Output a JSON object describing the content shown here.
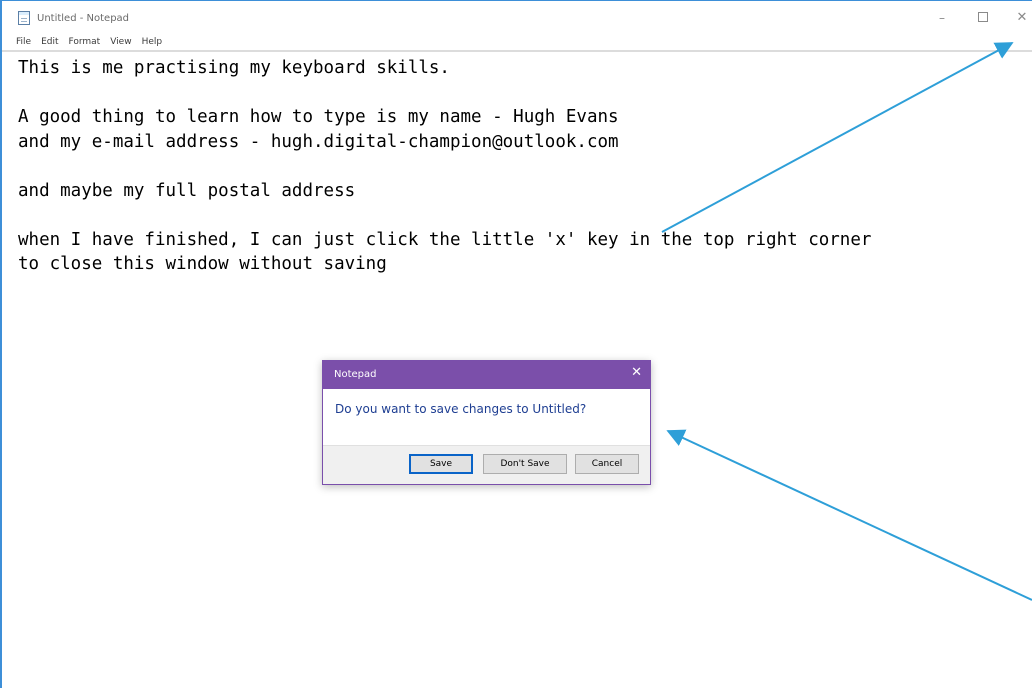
{
  "window": {
    "title": "Untitled - Notepad",
    "icon": "notepad-icon",
    "controls": {
      "minimize": "–",
      "close": "✕"
    }
  },
  "menu": {
    "items": [
      {
        "label": "File"
      },
      {
        "label": "Edit"
      },
      {
        "label": "Format"
      },
      {
        "label": "View"
      },
      {
        "label": "Help"
      }
    ]
  },
  "editor": {
    "lines": [
      "This is me practising my keyboard skills.",
      "",
      "A good thing to learn how to type is my name - Hugh Evans",
      "and my e-mail address - hugh.digital-champion@outlook.com",
      "",
      "and maybe my full postal address",
      "",
      "when I have finished, I can just click the little 'x' key in the top right corner",
      "to close this window without saving"
    ]
  },
  "dialog": {
    "title": "Notepad",
    "close": "✕",
    "message": "Do you want to save changes to Untitled?",
    "buttons": {
      "save": "Save",
      "dont_save": "Don't Save",
      "cancel": "Cancel"
    }
  },
  "colors": {
    "window_border": "#3d8fd8",
    "dialog_title_bg": "#7b4faa",
    "dialog_message": "#1e3e92",
    "annotation_arrow": "#2e9fd8"
  }
}
